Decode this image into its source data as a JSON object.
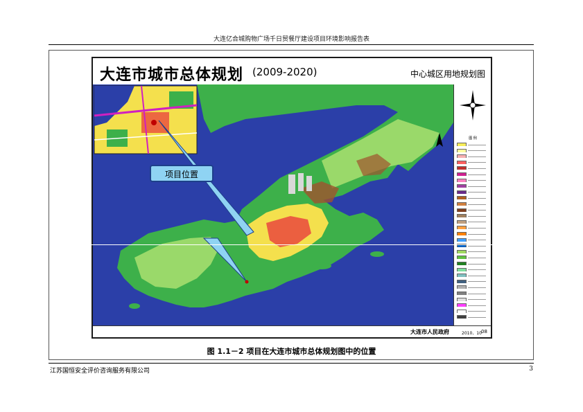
{
  "document": {
    "header_title": "大连亿合城购物广场千日贸餐厅建设项目环境影响报告表",
    "caption": "图 1.1－2    项目在大连市城市总体规划图中的位置",
    "footer_company": "江苏国恒安全评价咨询服务有限公司",
    "page_number": "3"
  },
  "map": {
    "title": "大连市城市总体规划",
    "years": "(2009-2020)",
    "subtitle": "中心城区用地规划图",
    "callout": "项目位置",
    "legend_title": "图  例",
    "government": "大连市人民政府",
    "date": "2010．10",
    "sheet_number": "08",
    "colors": {
      "sea": "#2b3fa8",
      "land_green": "#3db04a",
      "light_green": "#9ad96a",
      "residential": "#f4e04d",
      "industrial": "#a0522d",
      "commercial": "#e8343c",
      "callout_fill": "#8fd3f3",
      "callout_border": "#1e3f8a"
    }
  },
  "legend": {
    "swatches": [
      "#f6ec5a",
      "#ffffa0",
      "#f7b0b0",
      "#ff6060",
      "#c0302c",
      "#d02090",
      "#ff80c0",
      "#a040a0",
      "#6a2c8a",
      "#b06020",
      "#d08040",
      "#804020",
      "#a08060",
      "#c0a080",
      "#ffa040",
      "#ff8000",
      "#40a0ff",
      "#0060c0",
      "#a0d860",
      "#60c040",
      "#208020",
      "#80e0a0",
      "#80c0c0",
      "#406080",
      "#b0b0b0",
      "#808080",
      "#e0e0e0",
      "#ff40ff",
      "#ffffff",
      "#404040"
    ]
  }
}
